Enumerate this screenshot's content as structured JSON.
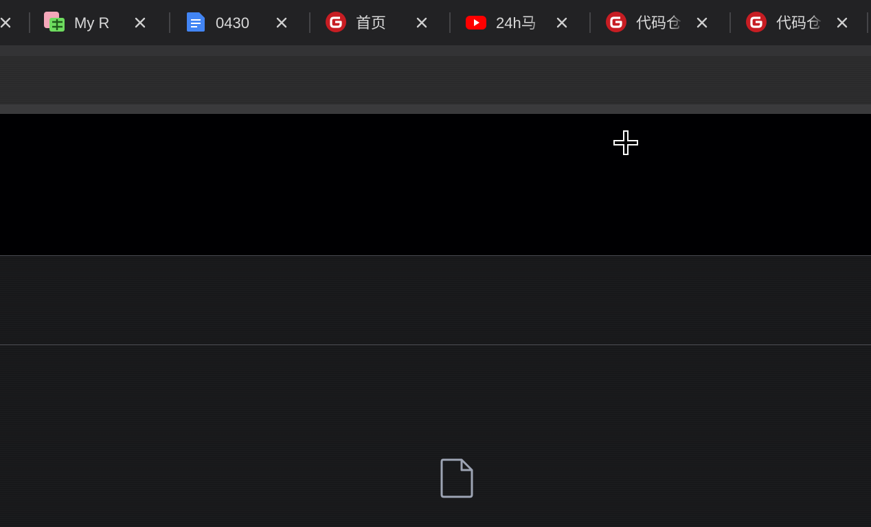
{
  "browser": {
    "tabs": [
      {
        "title": "My R",
        "favicon": "google-sheets-icon",
        "close_glyph": "✕"
      },
      {
        "title": "0430",
        "favicon": "google-docs-icon",
        "close_glyph": "✕"
      },
      {
        "title": "首页",
        "favicon": "gitee-icon",
        "close_glyph": "✕"
      },
      {
        "title": "24h马",
        "favicon": "youtube-icon",
        "close_glyph": "✕"
      },
      {
        "title": "代码仓",
        "favicon": "gitee-icon",
        "close_glyph": "✕"
      },
      {
        "title": "代码仓",
        "favicon": "gitee-icon",
        "close_glyph": "✕"
      }
    ],
    "colors": {
      "tab_strip": "#222224",
      "gitee_red": "#c71d23",
      "youtube_red": "#ff0000",
      "docs_blue": "#4285f4"
    }
  },
  "cursor": {
    "type": "crosshair"
  },
  "page": {
    "placeholder_icon": "file-icon"
  }
}
